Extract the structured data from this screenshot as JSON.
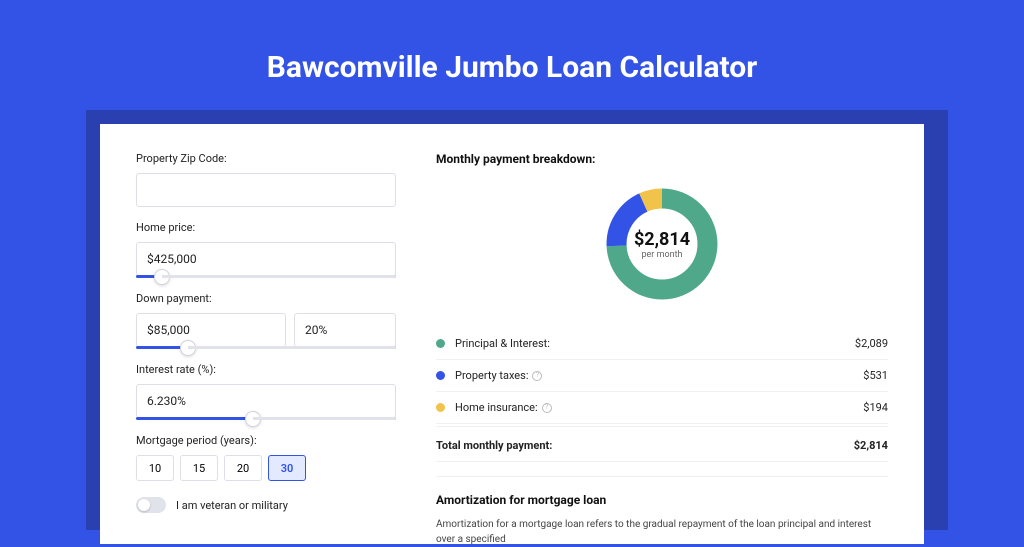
{
  "title": "Bawcomville Jumbo Loan Calculator",
  "form": {
    "zip": {
      "label": "Property Zip Code:",
      "value": ""
    },
    "home_price": {
      "label": "Home price:",
      "value": "$425,000",
      "slider_pct": 10
    },
    "down_payment": {
      "label": "Down payment:",
      "value": "$85,000",
      "percent": "20%",
      "slider_pct": 20
    },
    "interest": {
      "label": "Interest rate (%):",
      "value": "6.230%",
      "slider_pct": 45
    },
    "period": {
      "label": "Mortgage period (years):",
      "options": [
        "10",
        "15",
        "20",
        "30"
      ],
      "active": "30"
    },
    "veteran": {
      "label": "I am veteran or military",
      "checked": false
    }
  },
  "breakdown": {
    "title": "Monthly payment breakdown:",
    "total_amount": "$2,814",
    "per_month": "per month",
    "items": [
      {
        "name": "Principal & Interest:",
        "value": "$2,089",
        "color": "#4fa88a",
        "info": false
      },
      {
        "name": "Property taxes:",
        "value": "$531",
        "color": "#3253e6",
        "info": true
      },
      {
        "name": "Home insurance:",
        "value": "$194",
        "color": "#f1c34a",
        "info": true
      }
    ],
    "total_label": "Total monthly payment:",
    "total_value": "$2,814"
  },
  "chart_data": {
    "type": "pie",
    "title": "Monthly payment breakdown",
    "total": 2814,
    "series": [
      {
        "name": "Principal & Interest",
        "value": 2089,
        "color": "#4fa88a"
      },
      {
        "name": "Property taxes",
        "value": 531,
        "color": "#3253e6"
      },
      {
        "name": "Home insurance",
        "value": 194,
        "color": "#f1c34a"
      }
    ]
  },
  "amort": {
    "title": "Amortization for mortgage loan",
    "text": "Amortization for a mortgage loan refers to the gradual repayment of the loan principal and interest over a specified"
  }
}
